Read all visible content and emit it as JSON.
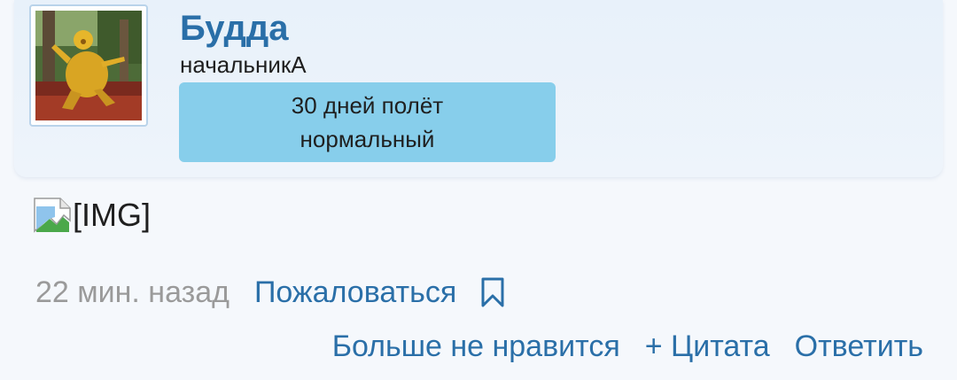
{
  "user": {
    "name": "Будда",
    "title": "начальникА",
    "badge_line1": "30 дней полёт",
    "badge_line2": "нормальный"
  },
  "post": {
    "image_placeholder": "[IMG]",
    "time": "22 мин. назад",
    "report_label": "Пожаловаться"
  },
  "actions": {
    "unlike": "Больше не нравится",
    "quote": "+ Цитата",
    "reply": "Ответить"
  },
  "icons": {
    "bookmark": "bookmark-icon",
    "broken_image": "broken-image-icon"
  },
  "colors": {
    "link": "#2a6fa8",
    "badge_bg": "#87ceeb",
    "muted": "#9a9a9a"
  }
}
